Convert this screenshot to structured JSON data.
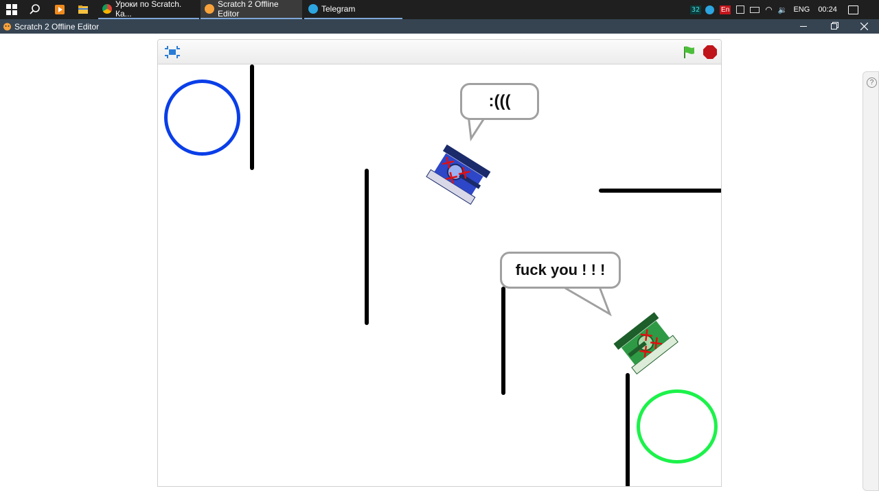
{
  "taskbar": {
    "tasks": [
      {
        "label": "Уроки по Scratch. Ка..."
      },
      {
        "label": "Scratch 2 Offline Editor"
      },
      {
        "label": "Telegram"
      }
    ],
    "tray": {
      "counter": "32",
      "lang_badge": "En",
      "language": "ENG",
      "time": "00:24"
    }
  },
  "window": {
    "title": "Scratch 2 Offline Editor"
  },
  "stage": {
    "speech_blue_tank": ":(((",
    "speech_green_tank": "fuck you ! ! !"
  },
  "colors": {
    "green_flag": "#4cbf3a",
    "stop": "#c0141b",
    "blue_ring": "#0a3ee8",
    "green_ring": "#1cf24a",
    "titlebar": "#364452",
    "taskbar": "#1f1f1f"
  },
  "icons": {
    "fullscreen": "presentation-mode-icon",
    "flag": "green-flag-icon",
    "stop": "stop-sign-icon",
    "help": "help-icon"
  },
  "help_label": "?"
}
